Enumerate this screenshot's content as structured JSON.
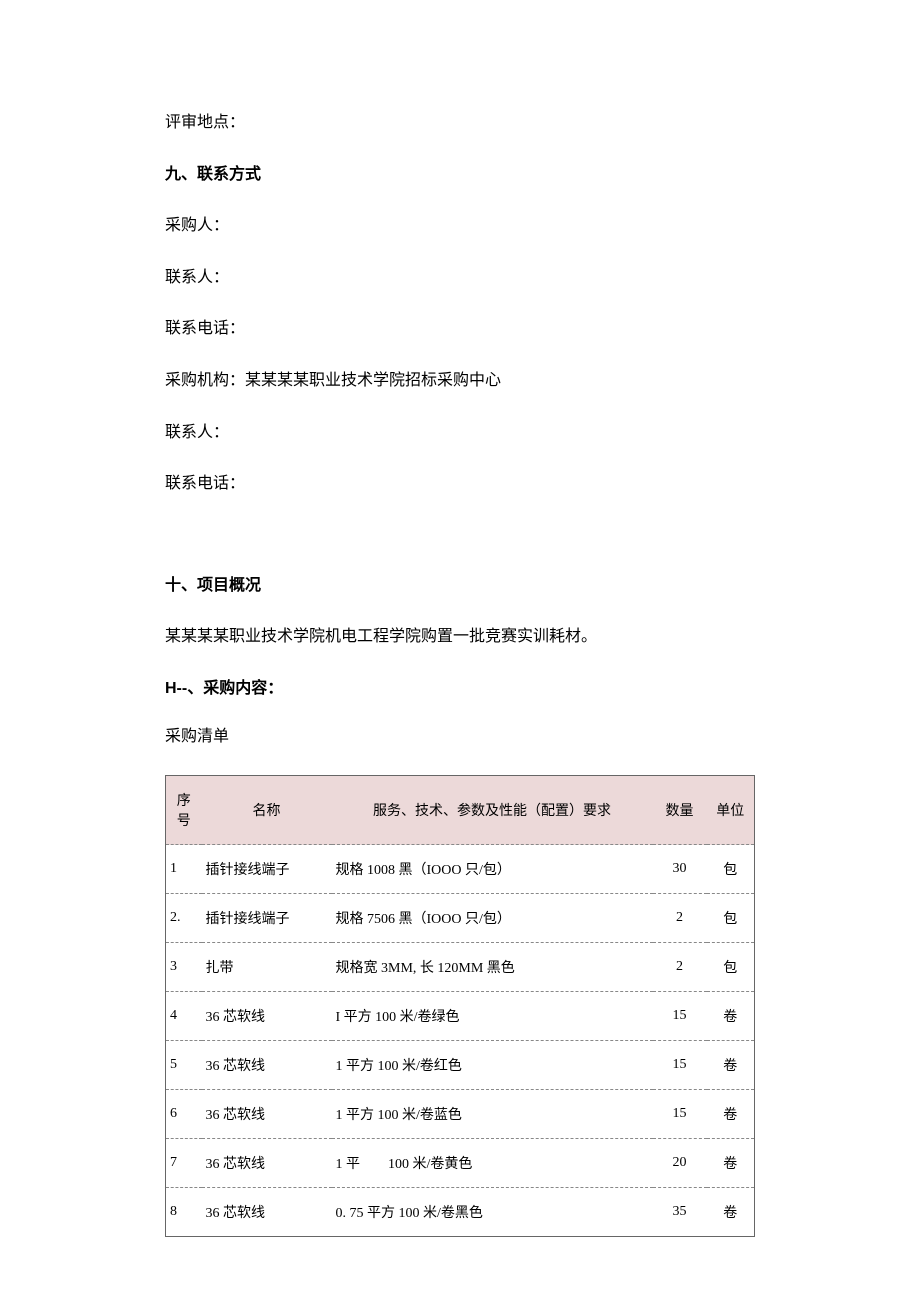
{
  "lines": {
    "review_location": "评审地点：",
    "h9": "九、联系方式",
    "buyer": "采购人：",
    "contact1": "联系人：",
    "phone1": "联系电话：",
    "agency": "采购机构：某某某某职业技术学院招标采购中心",
    "contact2": "联系人：",
    "phone2": "联系电话：",
    "h10": "十、项目概况",
    "overview": "某某某某职业技术学院机电工程学院购置一批竞赛实训耗材。",
    "h11": "H--、采购内容：",
    "list_title": "采购清单"
  },
  "table": {
    "headers": {
      "seq": "序号",
      "name": "名称",
      "spec": "服务、技术、参数及性能（配置）要求",
      "qty": "数量",
      "unit": "单位"
    },
    "rows": [
      {
        "seq": "1",
        "name": "插针接线端子",
        "spec": "规格 1008 黑（IOOO 只/包）",
        "qty": "30",
        "unit": "包"
      },
      {
        "seq": "2.",
        "name": "插针接线端子",
        "spec": "规格 7506 黑（IOOO 只/包）",
        "qty": "2",
        "unit": "包"
      },
      {
        "seq": "3",
        "name": "扎带",
        "spec": "规格宽 3MM, 长 120MM 黑色",
        "qty": "2",
        "unit": "包"
      },
      {
        "seq": "4",
        "name": "36 芯软线",
        "spec": "I 平方 100 米/卷绿色",
        "qty": "15",
        "unit": "卷"
      },
      {
        "seq": "5",
        "name": "36 芯软线",
        "spec": "1 平方 100 米/卷红色",
        "qty": "15",
        "unit": "卷"
      },
      {
        "seq": "6",
        "name": "36 芯软线",
        "spec": "1 平方 100 米/卷蓝色",
        "qty": "15",
        "unit": "卷"
      },
      {
        "seq": "7",
        "name": "36 芯软线",
        "spec": "1 平  100 米/卷黄色",
        "qty": "20",
        "unit": "卷"
      },
      {
        "seq": "8",
        "name": "36 芯软线",
        "spec": "0. 75 平方 100 米/卷黑色",
        "qty": "35",
        "unit": "卷"
      }
    ]
  }
}
